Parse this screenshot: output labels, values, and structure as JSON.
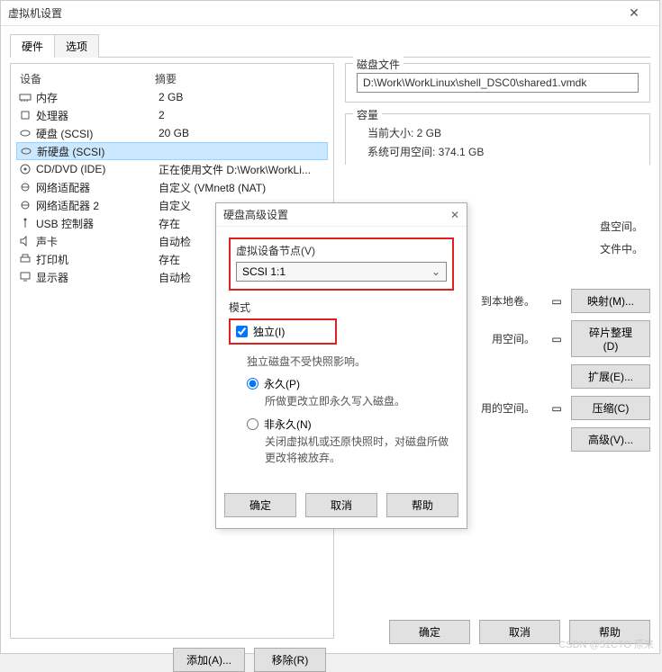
{
  "window": {
    "title": "虚拟机设置"
  },
  "tabs": {
    "hardware": "硬件",
    "options": "选项"
  },
  "device_headers": {
    "device": "设备",
    "summary": "摘要"
  },
  "devices": [
    {
      "name": "内存",
      "summary": "2 GB"
    },
    {
      "name": "处理器",
      "summary": "2"
    },
    {
      "name": "硬盘 (SCSI)",
      "summary": "20 GB"
    },
    {
      "name": "新硬盘 (SCSI)",
      "summary": ""
    },
    {
      "name": "CD/DVD (IDE)",
      "summary": "正在使用文件 D:\\Work\\WorkLi..."
    },
    {
      "name": "网络适配器",
      "summary": "自定义 (VMnet8 (NAT)"
    },
    {
      "name": "网络适配器 2",
      "summary": "自定义"
    },
    {
      "name": "USB 控制器",
      "summary": "存在"
    },
    {
      "name": "声卡",
      "summary": "自动检"
    },
    {
      "name": "打印机",
      "summary": "存在"
    },
    {
      "name": "显示器",
      "summary": "自动检"
    }
  ],
  "left_buttons": {
    "add": "添加(A)...",
    "remove": "移除(R)"
  },
  "right": {
    "diskfile": {
      "title": "磁盘文件",
      "path": "D:\\Work\\WorkLinux\\shell_DSC0\\shared1.vmdk"
    },
    "capacity": {
      "title": "容量",
      "current": "当前大小: 2 GB",
      "free": "系统可用空间: 374.1 GB"
    },
    "rowtexts": {
      "space": "盘空间。",
      "file": "文件中。",
      "volume": "到本地卷。",
      "usespace": "用空间。",
      "usedspace": "用的空间。"
    },
    "buttons": {
      "map": "映射(M)...",
      "defrag": "碎片整理(D)",
      "expand": "扩展(E)...",
      "compress": "压缩(C)",
      "advanced": "高级(V)..."
    }
  },
  "subdialog": {
    "title": "硬盘高级设置",
    "vdn_label": "虚拟设备节点(V)",
    "vdn_value": "SCSI 1:1",
    "mode_label": "模式",
    "independent": "独立(I)",
    "independent_desc": "独立磁盘不受快照影响。",
    "persistent": "永久(P)",
    "persistent_desc": "所做更改立即永久写入磁盘。",
    "nonpersistent": "非永久(N)",
    "nonpersistent_desc": "关闭虚拟机或还原快照时，对磁盘所做更改将被放弃。",
    "ok": "确定",
    "cancel": "取消",
    "help": "帮助"
  },
  "bottom": {
    "ok": "确定",
    "cancel": "取消",
    "help": "帮助"
  },
  "watermark": "CSDN @51CTO 原来"
}
